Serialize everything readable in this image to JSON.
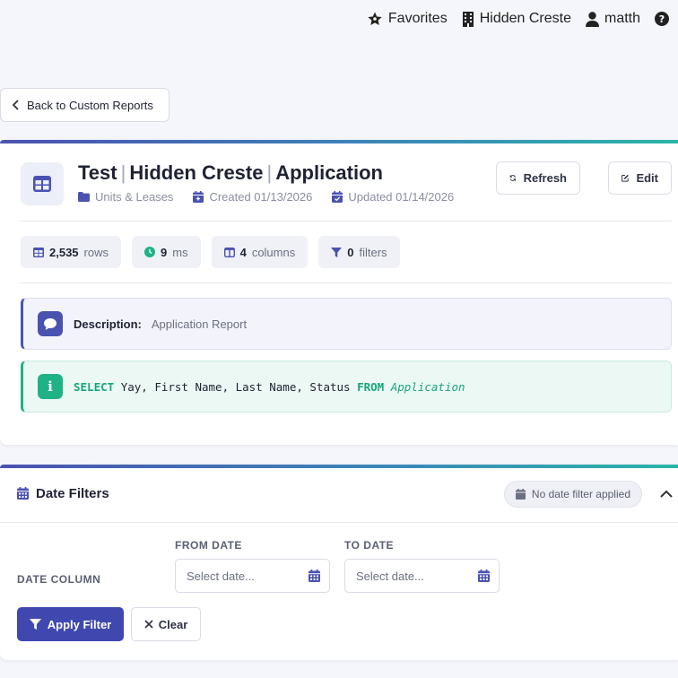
{
  "topbar": {
    "favorites": "Favorites",
    "property": "Hidden Creste",
    "user": "matth",
    "help": "?"
  },
  "back_label": "Back to Custom Reports",
  "report": {
    "title_parts": [
      "Test",
      "Hidden Creste",
      "Application"
    ],
    "title_separator": "|",
    "category": "Units & Leases",
    "created": "Created 01/13/2026",
    "updated": "Updated 01/14/2026",
    "refresh_label": "Refresh",
    "edit_label": "Edit",
    "stats": {
      "rows_value": "2,535",
      "rows_label": "rows",
      "ms_value": "9",
      "ms_label": "ms",
      "columns_value": "4",
      "columns_label": "columns",
      "filters_value": "0",
      "filters_label": "filters"
    },
    "description_label": "Description:",
    "description_value": "Application Report",
    "sql": {
      "icon_letter": "i",
      "select_kw": "SELECT",
      "columns": "Yay, First Name, Last Name, Status",
      "from_kw": "FROM",
      "table": "Application"
    }
  },
  "date_filters": {
    "title": "Date Filters",
    "badge": "No date filter applied",
    "date_column_label": "DATE COLUMN",
    "from_label": "FROM DATE",
    "to_label": "TO DATE",
    "from_placeholder": "Select date...",
    "to_placeholder": "Select date...",
    "apply_label": "Apply Filter",
    "clear_label": "Clear"
  },
  "colors": {
    "primary": "#4048b0",
    "success": "#1fb287",
    "text": "#1f2233",
    "muted": "#8a8ea0"
  }
}
